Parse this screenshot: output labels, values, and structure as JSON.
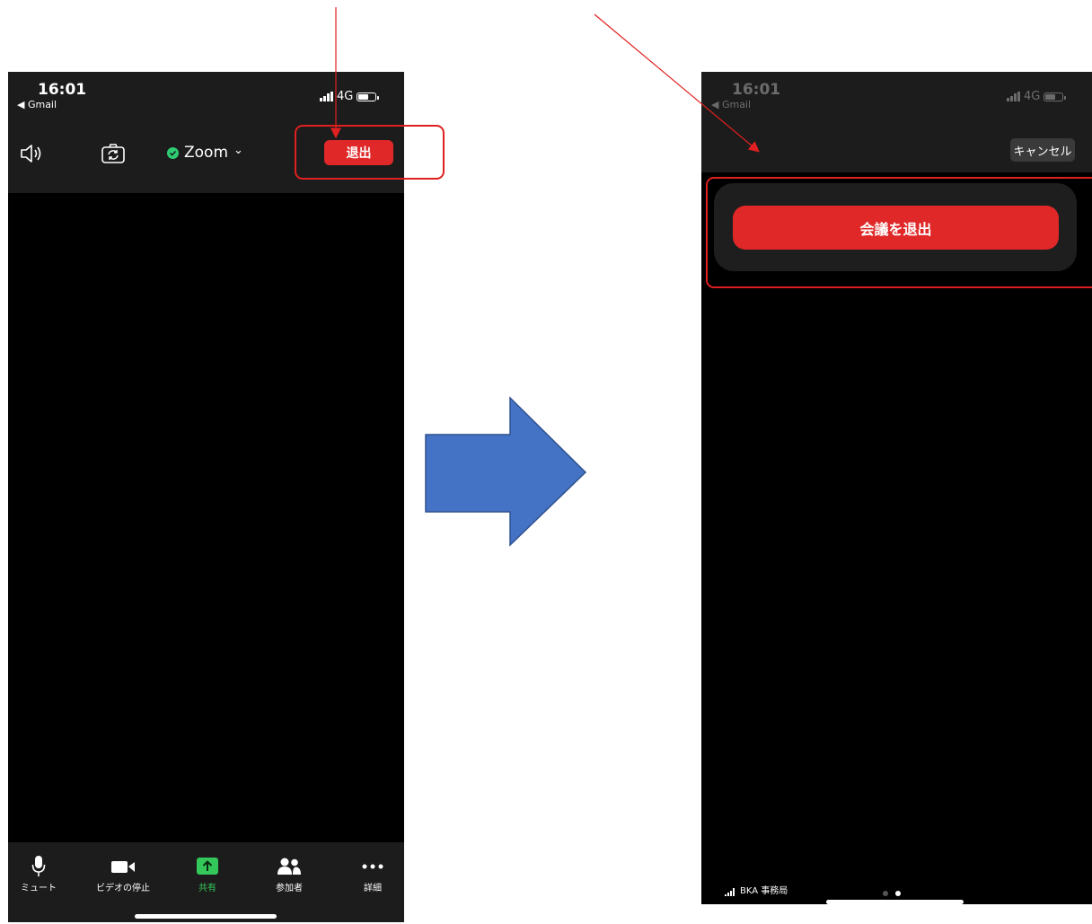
{
  "left_screen": {
    "status": {
      "time": "16:01",
      "back_app": "◀ Gmail",
      "network": "4G"
    },
    "top_bar": {
      "speaker_icon": "speaker-icon",
      "camera_flip_icon": "camera-flip-icon",
      "meeting_title": "Zoom",
      "title_chevron": "⌄",
      "leave_label": "退出"
    },
    "toolbar": [
      {
        "label": "ミュート",
        "icon": "mic-icon"
      },
      {
        "label": "ビデオの停止",
        "icon": "video-icon"
      },
      {
        "label": "共有",
        "icon": "share-icon"
      },
      {
        "label": "参加者",
        "icon": "participants-icon"
      },
      {
        "label": "詳細",
        "icon": "more-icon"
      }
    ]
  },
  "right_screen": {
    "status": {
      "time": "16:01",
      "back_app": "◀ Gmail",
      "network": "4G"
    },
    "cancel_label": "キャンセル",
    "leave_meeting_label": "会議を退出",
    "network_label": "BKA 事務局",
    "page_dots": 2,
    "active_page": 2
  },
  "colors": {
    "leave_red": "#e02828",
    "annotation_red": "#e02020",
    "arrow_blue": "#4472c4",
    "share_green": "#34c759"
  }
}
